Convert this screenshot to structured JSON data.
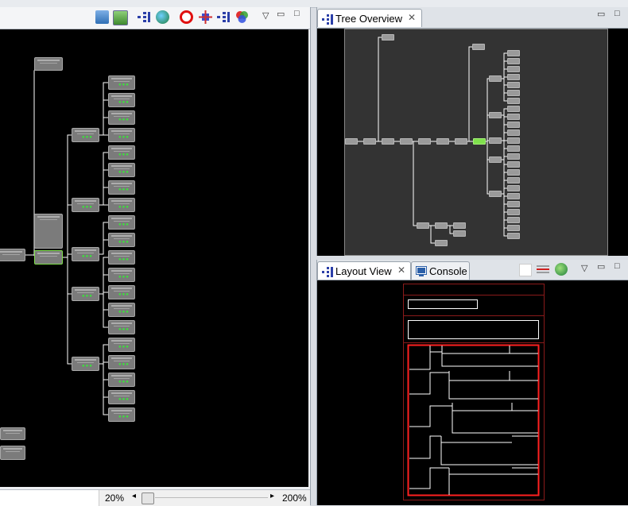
{
  "left_panel": {
    "zoom_min_label": "20%",
    "zoom_max_label": "200%"
  },
  "tree_overview": {
    "tab_label": "Tree Overview"
  },
  "layout_view": {
    "tab_label": "Layout View",
    "console_tab_label": "Console"
  },
  "colors": {
    "canvas_bg": "#000000",
    "node_fill": "#7b7b7b",
    "selected_node": "#7fe04c",
    "layout_border": "#ff2020",
    "status_dots": "#3be43b"
  },
  "icons": [
    "layout-icon",
    "display-icon",
    "tree-icon",
    "globe-icon",
    "stop-icon",
    "capture-icon",
    "tree-icon",
    "color-icon",
    "menu-icon",
    "minimize-icon",
    "maximize-icon"
  ]
}
